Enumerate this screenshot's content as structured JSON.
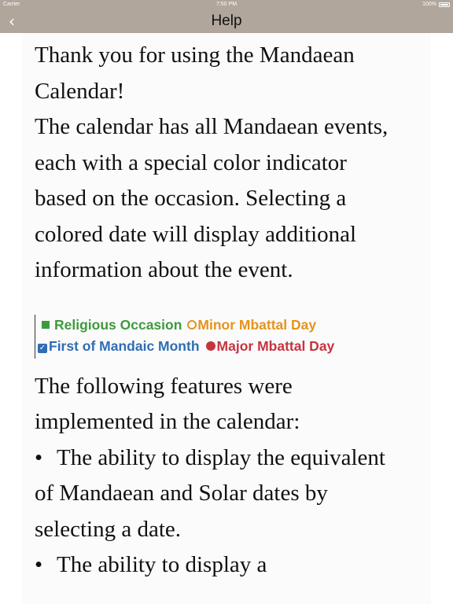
{
  "status_bar": {
    "carrier": "Carrier",
    "time": "7:50 PM",
    "battery": "100%"
  },
  "nav": {
    "back_glyph": "‹",
    "title": "Help"
  },
  "content": {
    "intro_line1": "Thank you for using the Mandaean",
    "intro_line2": "Calendar!",
    "intro_body": "The calendar has all Mandaean events, each with a special color indicator based on the occasion. Selecting a colored date will display additional information about the event.",
    "features_intro": "The following features were implemented in the calendar:",
    "features": [
      "The ability to display the equivalent of Mandaean and Solar dates by selecting a date.",
      "The ability to display a"
    ],
    "bullet_glyph": "•"
  },
  "legend": {
    "religious_occasion": "Religious Occasion",
    "minor_mbattal_day": "Minor Mbattal Day",
    "first_of_mandaic_month": "First of Mandaic Month",
    "major_mbattal_day": "Major Mbattal Day",
    "colors": {
      "religious_occasion": "#3e9a3e",
      "minor_mbattal_day": "#e6931d",
      "first_of_mandaic_month": "#2f6db4",
      "major_mbattal_day": "#c63440"
    }
  },
  "theme": {
    "nav_background": "#b0a69c"
  }
}
